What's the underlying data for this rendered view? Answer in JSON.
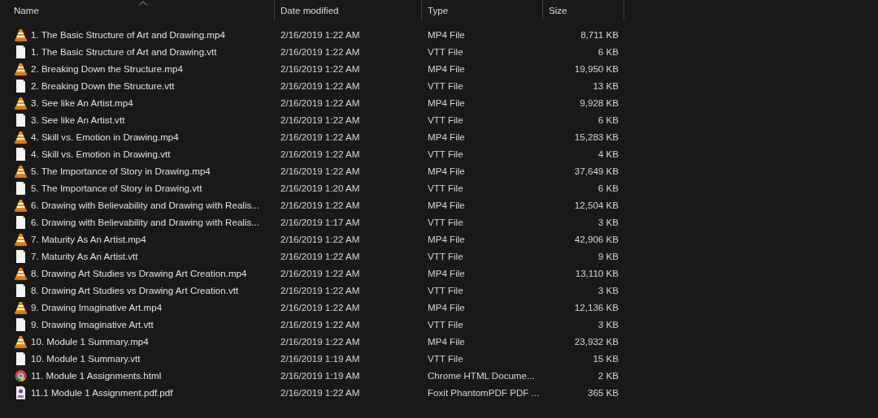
{
  "columns": [
    {
      "label": "Name",
      "sorted": true
    },
    {
      "label": "Date modified",
      "sorted": false
    },
    {
      "label": "Type",
      "sorted": false
    },
    {
      "label": "Size",
      "sorted": false
    }
  ],
  "files": [
    {
      "kind": "vlc",
      "name": "1. The Basic Structure of Art and Drawing.mp4",
      "date": "2/16/2019 1:22 AM",
      "type": "MP4 File",
      "size": "8,711 KB"
    },
    {
      "kind": "text",
      "name": "1. The Basic Structure of Art and Drawing.vtt",
      "date": "2/16/2019 1:22 AM",
      "type": "VTT File",
      "size": "6 KB"
    },
    {
      "kind": "vlc",
      "name": "2. Breaking Down the Structure.mp4",
      "date": "2/16/2019 1:22 AM",
      "type": "MP4 File",
      "size": "19,950 KB"
    },
    {
      "kind": "text",
      "name": "2. Breaking Down the Structure.vtt",
      "date": "2/16/2019 1:22 AM",
      "type": "VTT File",
      "size": "13 KB"
    },
    {
      "kind": "vlc",
      "name": "3. See like An Artist.mp4",
      "date": "2/16/2019 1:22 AM",
      "type": "MP4 File",
      "size": "9,928 KB"
    },
    {
      "kind": "text",
      "name": "3. See like An Artist.vtt",
      "date": "2/16/2019 1:22 AM",
      "type": "VTT File",
      "size": "6 KB"
    },
    {
      "kind": "vlc",
      "name": "4. Skill vs. Emotion in Drawing.mp4",
      "date": "2/16/2019 1:22 AM",
      "type": "MP4 File",
      "size": "15,283 KB"
    },
    {
      "kind": "text",
      "name": "4. Skill vs. Emotion in Drawing.vtt",
      "date": "2/16/2019 1:22 AM",
      "type": "VTT File",
      "size": "4 KB"
    },
    {
      "kind": "vlc",
      "name": "5. The Importance of Story in Drawing.mp4",
      "date": "2/16/2019 1:22 AM",
      "type": "MP4 File",
      "size": "37,649 KB"
    },
    {
      "kind": "text",
      "name": "5. The Importance of Story in Drawing.vtt",
      "date": "2/16/2019 1:20 AM",
      "type": "VTT File",
      "size": "6 KB"
    },
    {
      "kind": "vlc",
      "name": "6. Drawing with Believability and Drawing with Realis...",
      "date": "2/16/2019 1:22 AM",
      "type": "MP4 File",
      "size": "12,504 KB"
    },
    {
      "kind": "text",
      "name": "6. Drawing with Believability and Drawing with Realis...",
      "date": "2/16/2019 1:17 AM",
      "type": "VTT File",
      "size": "3 KB"
    },
    {
      "kind": "vlc",
      "name": "7. Maturity As An Artist.mp4",
      "date": "2/16/2019 1:22 AM",
      "type": "MP4 File",
      "size": "42,906 KB"
    },
    {
      "kind": "text",
      "name": "7. Maturity As An Artist.vtt",
      "date": "2/16/2019 1:22 AM",
      "type": "VTT File",
      "size": "9 KB"
    },
    {
      "kind": "vlc",
      "name": "8. Drawing Art Studies vs Drawing Art Creation.mp4",
      "date": "2/16/2019 1:22 AM",
      "type": "MP4 File",
      "size": "13,110 KB"
    },
    {
      "kind": "text",
      "name": "8. Drawing Art Studies vs Drawing Art Creation.vtt",
      "date": "2/16/2019 1:22 AM",
      "type": "VTT File",
      "size": "3 KB"
    },
    {
      "kind": "vlc",
      "name": "9. Drawing Imaginative Art.mp4",
      "date": "2/16/2019 1:22 AM",
      "type": "MP4 File",
      "size": "12,136 KB"
    },
    {
      "kind": "text",
      "name": "9. Drawing Imaginative Art.vtt",
      "date": "2/16/2019 1:22 AM",
      "type": "VTT File",
      "size": "3 KB"
    },
    {
      "kind": "vlc",
      "name": "10. Module 1 Summary.mp4",
      "date": "2/16/2019 1:22 AM",
      "type": "MP4 File",
      "size": "23,932 KB"
    },
    {
      "kind": "text",
      "name": "10. Module 1 Summary.vtt",
      "date": "2/16/2019 1:19 AM",
      "type": "VTT File",
      "size": "15 KB"
    },
    {
      "kind": "browser",
      "name": "11. Module 1 Assignments.html",
      "date": "2/16/2019 1:19 AM",
      "type": "Chrome HTML Docume...",
      "size": "2 KB"
    },
    {
      "kind": "pdf",
      "name": "11.1 Module 1 Assignment.pdf.pdf",
      "date": "2/16/2019 1:22 AM",
      "type": "Foxit PhantomPDF PDF ...",
      "size": "365 KB"
    }
  ]
}
